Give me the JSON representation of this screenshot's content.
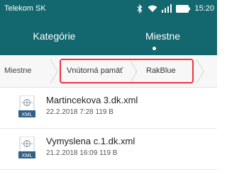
{
  "status_bar": {
    "carrier": "Telekom SK",
    "time": "15:20",
    "icons": [
      "bluetooth-icon",
      "wifi-icon",
      "signal-icon",
      "battery-icon"
    ]
  },
  "tabs": [
    {
      "label": "Kategórie",
      "active": false
    },
    {
      "label": "Miestne",
      "active": true
    }
  ],
  "breadcrumb": {
    "items": [
      "Miestne",
      "Vnútorná pamäť",
      "RakBlue"
    ]
  },
  "files": [
    {
      "name": "Martincekova 3.dk.xml",
      "meta": "22.2.2018 7:28 119 B",
      "icon_label": "XML"
    },
    {
      "name": "Vymyslena c.1.dk.xml",
      "meta": "21.2.2018 16:09 119 B",
      "icon_label": "XML"
    }
  ],
  "colors": {
    "header_bg": "#12686e",
    "highlight": "#ef3340",
    "xml_badge": "#2f5f8a"
  }
}
